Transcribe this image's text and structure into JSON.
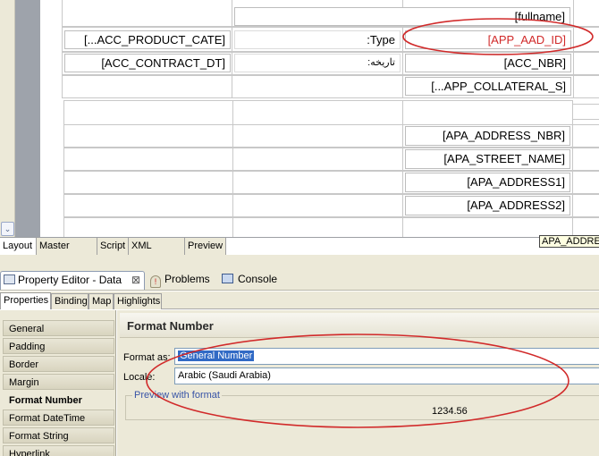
{
  "canvas": {
    "scroll_down_glyph": "⌄",
    "row_fullname": "[fullname]",
    "row_product_cate": "[...ACC_PRODUCT_CATE]",
    "row_type_label": ":Type",
    "row_app_aad_id": "[APP_AAD_ID]",
    "row_contract_dt": "[ACC_CONTRACT_DT]",
    "row_date_label": ":تاريخه",
    "row_acc_nbr": "[ACC_NBR]",
    "row_collateral": "[...APP_COLLATERAL_S]",
    "row_address_nbr": "[APA_ADDRESS_NBR]",
    "row_street_name": "[APA_STREET_NAME]",
    "row_address1": "[APA_ADDRESS1]",
    "row_address2": "[APA_ADDRESS2]",
    "hover_tooltip": "APA_ADDRESS"
  },
  "editor_tabs": [
    {
      "label": "Layout"
    },
    {
      "label": "Master Page"
    },
    {
      "label": "Script"
    },
    {
      "label": "XML Source"
    },
    {
      "label": "Preview"
    }
  ],
  "views": {
    "property_editor": "Property Editor - Data",
    "close_glyph": "⊠",
    "problems": "Problems",
    "console": "Console"
  },
  "sub_tabs": [
    {
      "label": "Properties"
    },
    {
      "label": "Binding"
    },
    {
      "label": "Map"
    },
    {
      "label": "Highlights"
    }
  ],
  "nav_items": [
    {
      "label": "General"
    },
    {
      "label": "Padding"
    },
    {
      "label": "Border"
    },
    {
      "label": "Margin"
    },
    {
      "label": "Format Number"
    },
    {
      "label": "Format DateTime"
    },
    {
      "label": "Format String"
    },
    {
      "label": "Hyperlink"
    }
  ],
  "format_panel": {
    "title": "Format Number",
    "format_as_label": "Format as:",
    "format_as_value": "General Number",
    "locale_label": "Locale:",
    "locale_value": "Arabic (Saudi Arabia)",
    "preview_label": "Preview with format",
    "preview_value": "1234.56"
  },
  "colors": {
    "annotation": "#d12a2a",
    "selection": "#316ac5",
    "chrome": "#ece9d8"
  }
}
